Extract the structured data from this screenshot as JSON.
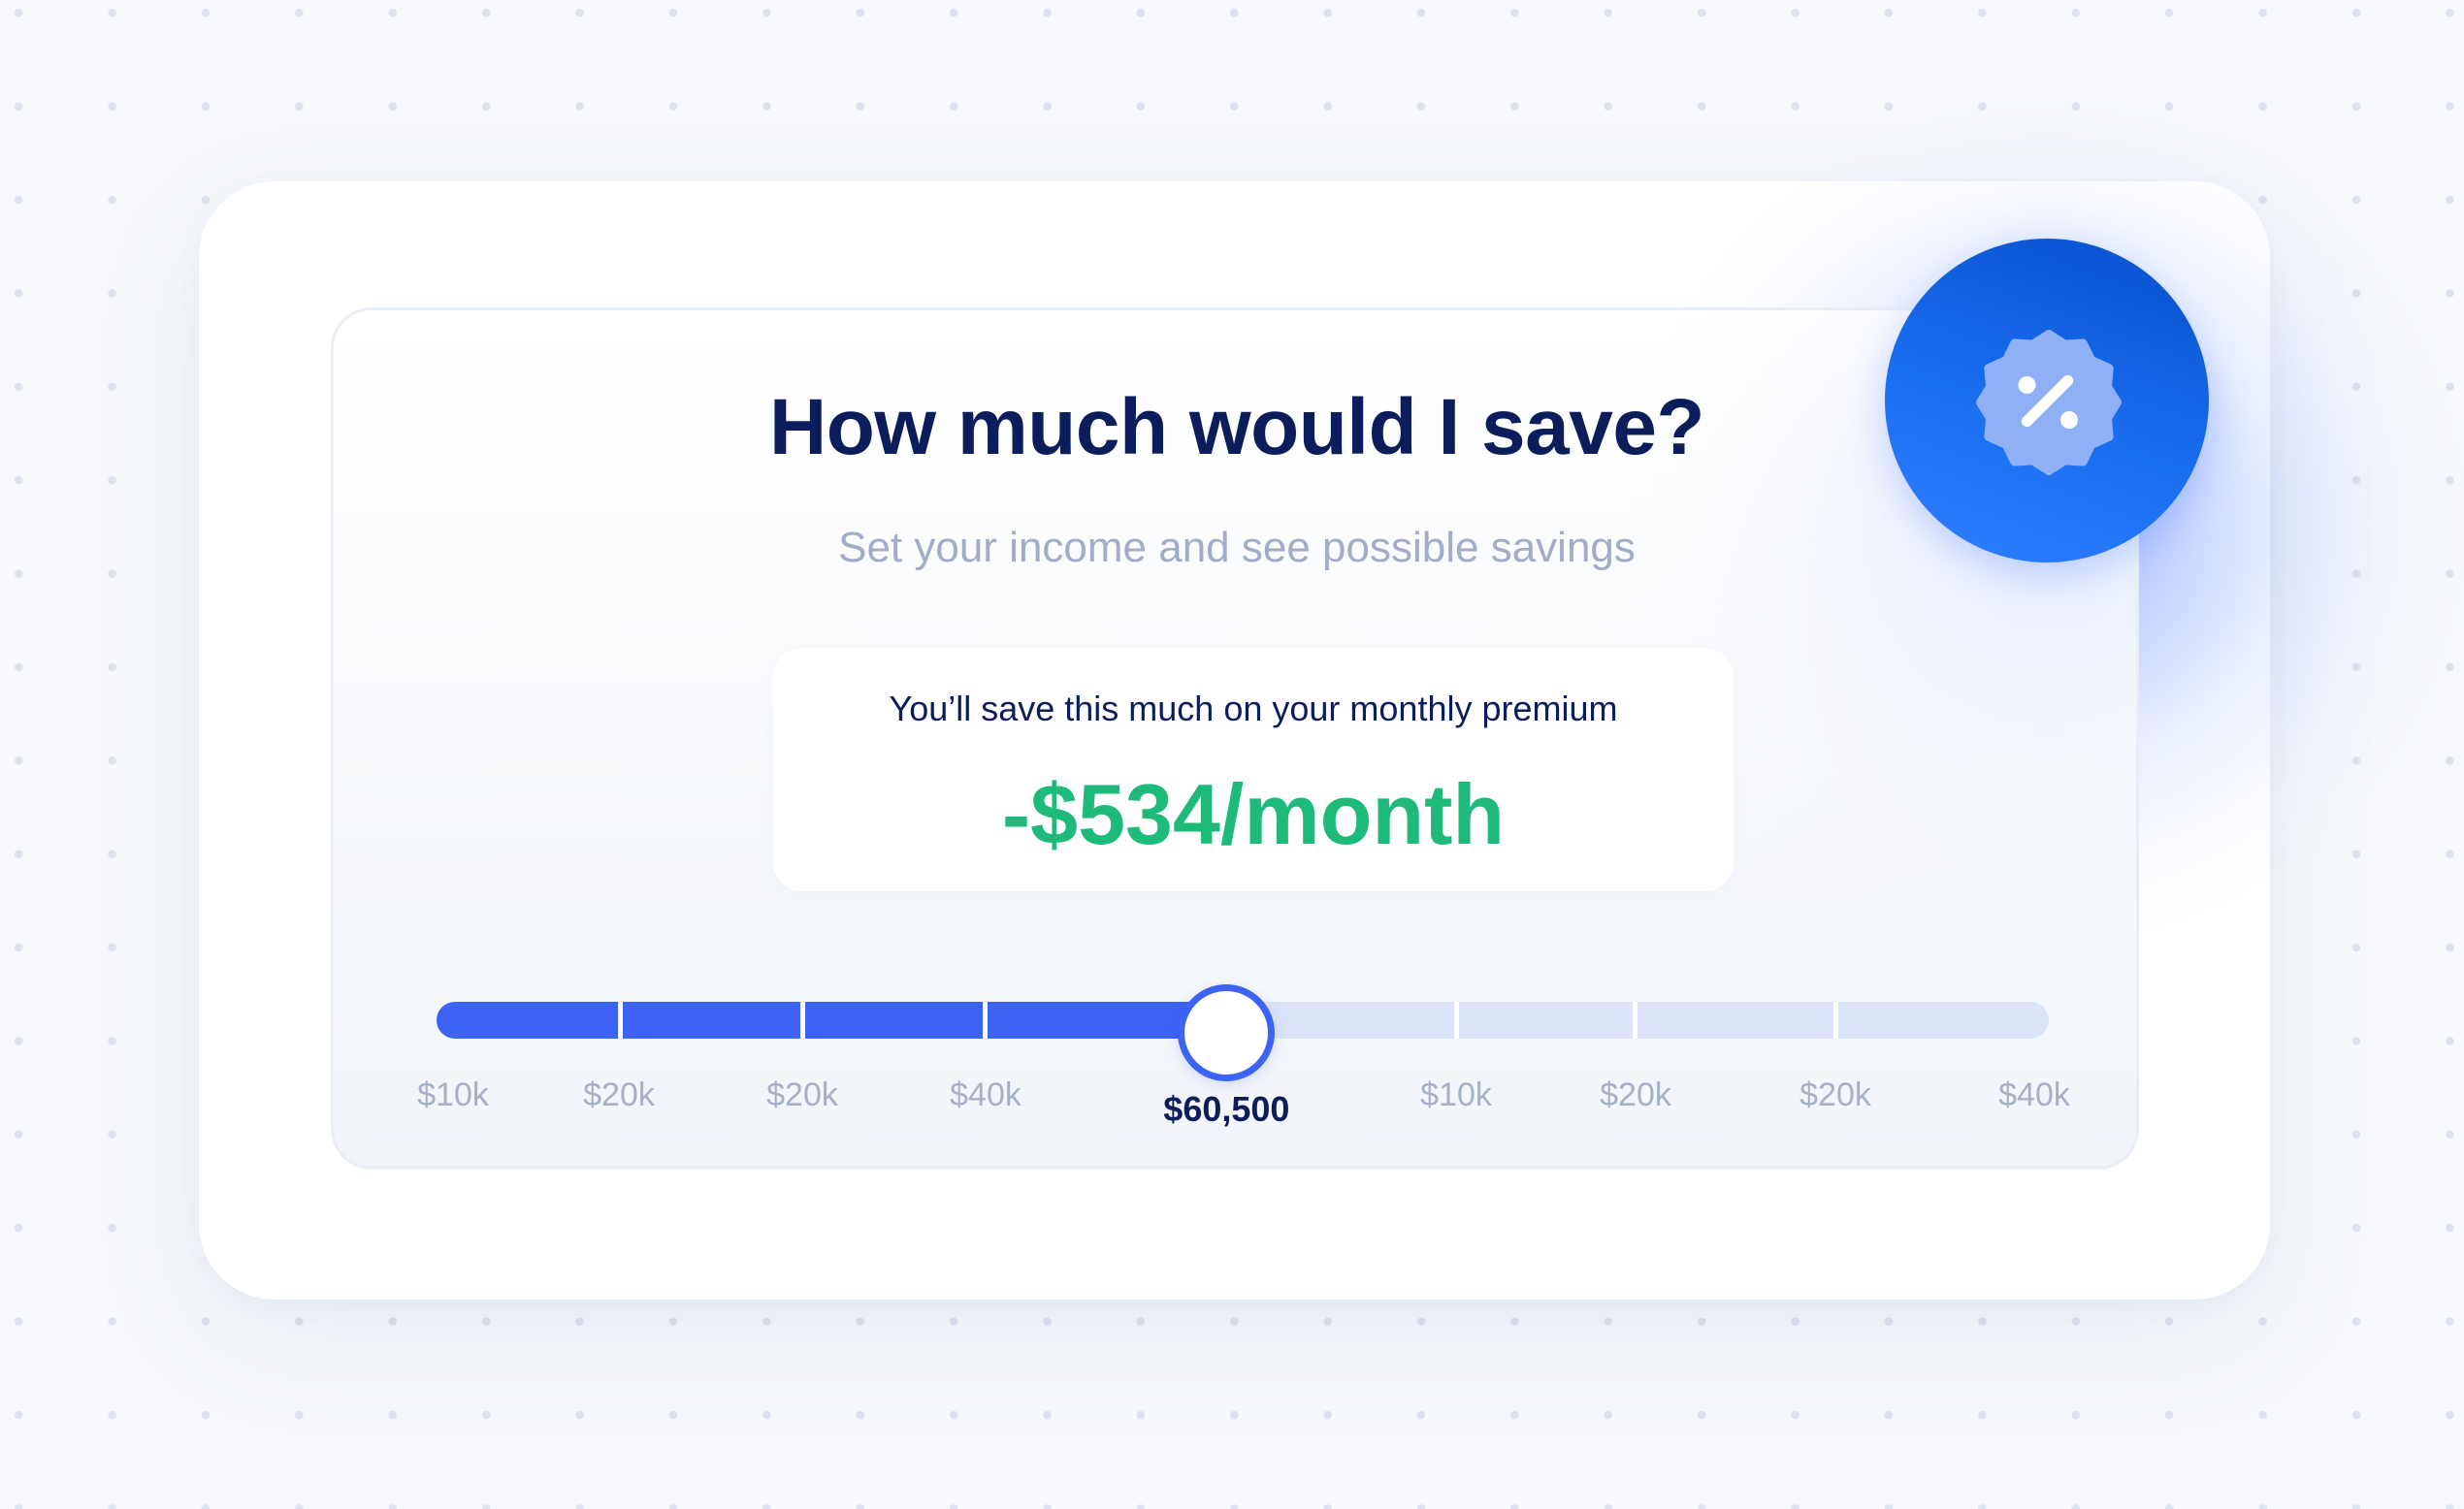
{
  "header": {
    "title": "How much would I save?",
    "subtitle": "Set your income and see possible savings"
  },
  "result": {
    "label": "You’ll save this much on your monthly premium",
    "value": "-$534/month"
  },
  "badge": {
    "icon": "percent-badge-icon"
  },
  "slider": {
    "current_value_label": "$60,500",
    "position_fraction": 0.49,
    "tick_labels": [
      "$10k",
      "$20k",
      "$20k",
      "$40k",
      "$10k",
      "$20k",
      "$20k",
      "$40k"
    ]
  },
  "colors": {
    "accent": "#3d63f5",
    "savings_green": "#1dba7a",
    "heading_navy": "#0b1e5b",
    "badge_blue": "#1a6ef0"
  }
}
